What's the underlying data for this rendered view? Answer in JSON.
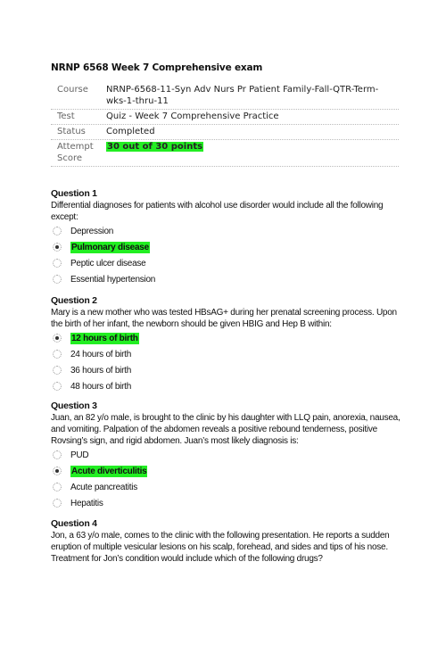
{
  "title": "NRNP 6568 Week 7 Comprehensive exam",
  "meta": [
    {
      "label": "Course",
      "value": "NRNP-6568-11-Syn Adv Nurs Pr Patient Family-Fall-QTR-Term-wks-1-thru-11"
    },
    {
      "label": "Test",
      "value": "Quiz - Week 7 Comprehensive Practice"
    },
    {
      "label": "Status",
      "value": "Completed"
    },
    {
      "label": "Attempt Score",
      "value": "30 out of 30 points",
      "highlight_color": "#22ee22"
    }
  ],
  "questions": [
    {
      "heading": "Question 1",
      "text": "Differential diagnoses for patients with alcohol use disorder would include all the following except:",
      "options": [
        "Depression",
        "Pulmonary disease",
        "Peptic ulcer disease",
        "Essential hypertension"
      ],
      "selected": 1
    },
    {
      "heading": "Question 2",
      "text": "Mary is a new mother who was tested HBsAG+ during her prenatal screening process. Upon the birth of her infant, the newborn should be given HBIG and Hep B within:",
      "options": [
        "12 hours of birth",
        "24 hours of birth",
        "36 hours of birth",
        "48 hours of birth"
      ],
      "selected": 0
    },
    {
      "heading": "Question 3",
      "text": "Juan, an 82 y/o male, is brought to the clinic by his daughter with LLQ pain, anorexia, nausea, and vomiting. Palpation of the abdomen reveals a positive rebound tenderness, positive Rovsing’s sign, and rigid abdomen. Juan’s most likely diagnosis is:",
      "options": [
        "PUD",
        "Acute diverticulitis",
        "Acute pancreatitis",
        "Hepatitis"
      ],
      "selected": 1
    },
    {
      "heading": "Question 4",
      "text": "Jon, a 63 y/o male, comes to the clinic with the following presentation. He reports a sudden eruption of multiple vesicular lesions on his scalp, forehead, and sides and tips of his nose. Treatment for Jon’s condition would include which of the following drugs?",
      "options": [],
      "selected": null
    }
  ]
}
